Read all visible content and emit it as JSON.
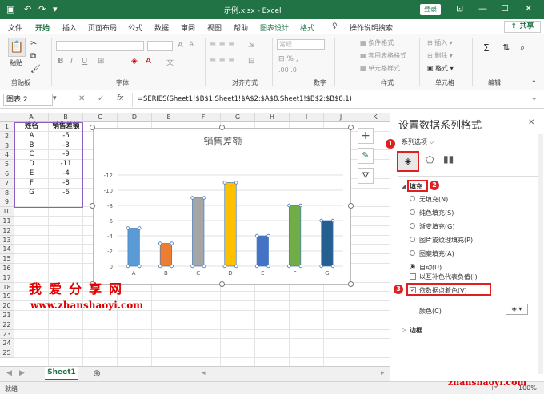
{
  "titlebar": {
    "filename": "示例.xlsx - Excel",
    "login": "登录"
  },
  "tabs": [
    "文件",
    "开始",
    "插入",
    "页面布局",
    "公式",
    "数据",
    "审阅",
    "视图",
    "帮助",
    "图表设计",
    "格式"
  ],
  "tellme": "操作说明搜索",
  "share": "共享",
  "ribbon": {
    "paste": "粘贴",
    "groups": [
      "剪贴板",
      "字体",
      "对齐方式",
      "数字",
      "样式",
      "单元格",
      "编辑"
    ],
    "number_format": "常规",
    "styles": [
      "条件格式",
      "套用表格格式",
      "单元格样式"
    ],
    "cells": [
      "插入",
      "删除",
      "格式"
    ]
  },
  "formulabar": {
    "namebox": "图表 2",
    "fx": "fx",
    "formula": "=SERIES(Sheet1!$B$1,Sheet1!$A$2:$A$8,Sheet1!$B$2:$B$8,1)"
  },
  "sheet": {
    "columns": [
      "A",
      "B",
      "C",
      "D",
      "E",
      "F",
      "G",
      "H",
      "I",
      "J",
      "K"
    ],
    "rows": [
      "1",
      "2",
      "3",
      "4",
      "5",
      "6",
      "7",
      "8",
      "9",
      "10",
      "11",
      "12",
      "13",
      "14",
      "15",
      "16",
      "17",
      "18",
      "19",
      "20",
      "21",
      "22",
      "23",
      "24",
      "25"
    ],
    "header": [
      "姓名",
      "销售差额"
    ],
    "names": [
      "A",
      "B",
      "C",
      "D",
      "E",
      "F",
      "G"
    ],
    "values": [
      "-5",
      "-3",
      "-9",
      "-11",
      "-4",
      "-8",
      "-6"
    ]
  },
  "chart_data": {
    "type": "bar",
    "title": "销售差额",
    "categories": [
      "A",
      "B",
      "C",
      "D",
      "E",
      "F",
      "G"
    ],
    "values": [
      -5,
      -3,
      -9,
      -11,
      -4,
      -8,
      -6
    ],
    "ylim": [
      0,
      -12
    ],
    "yticks": [
      "0",
      "-2",
      "-4",
      "-6",
      "-8",
      "-10",
      "-12"
    ],
    "colors": [
      "#5b9bd5",
      "#ed7d31",
      "#a5a5a5",
      "#ffc000",
      "#4472c4",
      "#70ad47",
      "#255e91"
    ],
    "inverted_axis": true,
    "grid": true
  },
  "watermark": {
    "text": "我爱分享网",
    "url": "www.zhanshaoyi.com",
    "corner": "zhanshaoyi.com"
  },
  "sheettab": "Sheet1",
  "status": {
    "ready": "就绪",
    "zoom": "100%"
  },
  "pane": {
    "title": "设置数据系列格式",
    "series_options": "系列选项",
    "fill_section": "填充",
    "fill_options": [
      "无填充(N)",
      "纯色填充(S)",
      "渐变填充(G)",
      "图片或纹理填充(P)",
      "图案填充(A)",
      "自动(U)"
    ],
    "invert_negative": "以互补色代表负值(I)",
    "vary_colors": "依数据点着色(V)",
    "color_label": "颜色(C)",
    "border_section": "边框",
    "badges": [
      "1",
      "2",
      "3"
    ]
  }
}
